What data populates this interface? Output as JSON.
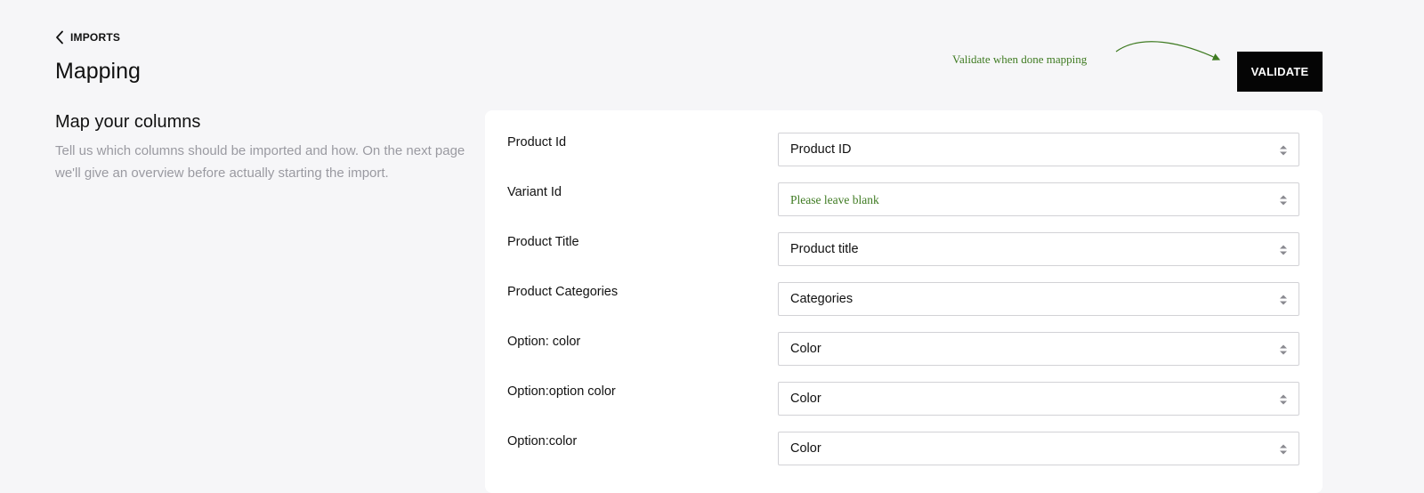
{
  "header": {
    "back_label": "IMPORTS",
    "title": "Mapping",
    "validate_label": "VALIDATE"
  },
  "annotations": {
    "validate_hint": "Validate when done mapping",
    "color": "#3f7b22"
  },
  "section": {
    "title": "Map your columns",
    "description": "Tell us which columns should be imported and how. On the next page we'll give an overview before actually starting the import."
  },
  "mapping_rows": [
    {
      "column": "Product Id",
      "field": "Product ID"
    },
    {
      "column": "Variant Id",
      "field": "Please leave blank"
    },
    {
      "column": "Product Title",
      "field": "Product title"
    },
    {
      "column": "Product Categories",
      "field": "Categories"
    },
    {
      "column": "Option: color",
      "field": "Color"
    },
    {
      "column": "Option:option color",
      "field": "Color"
    },
    {
      "column": "Option:color",
      "field": "Color"
    }
  ],
  "icons": {
    "back": "chevron-left-icon",
    "select": "sort-arrows-icon"
  },
  "colors": {
    "background": "#f6f6f8",
    "button": "#050505",
    "annotation": "#3f7b22"
  }
}
